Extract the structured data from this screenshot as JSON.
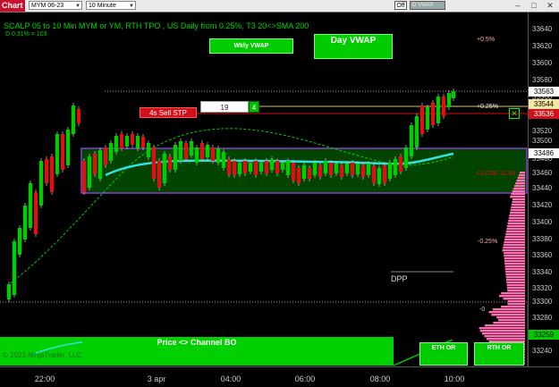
{
  "toolbar": {
    "chart_tab": "Chart",
    "instrument": "MYM 06-23",
    "interval": "10 Minute",
    "off_button": "Off",
    "dvwap_button": "D VWAP"
  },
  "header": {
    "title": "SCALP 05 to 10 Min MYM or YM, RTH TPO , US Daily from 0.25%, T3 20<>SMA 200",
    "subtitle": "D 0,31% = 103"
  },
  "buttons": {
    "wkly_vwap": "Wkly VWAP",
    "day_vwap": "Day VWAP",
    "price_channel": "Price <> Channel BO",
    "eth_or": "ETH OR",
    "rth_or": "RTH OR"
  },
  "order": {
    "sell_label": "4s Sell STP",
    "quantity": "19",
    "side_qty": "4",
    "close_icon": "close-x"
  },
  "labels": {
    "pct_05": "+0.5%",
    "pct_025": "+0.25%",
    "pct_m025": "-0.25%",
    "pct_0": "-0",
    "close": "CLOSE 31.90",
    "dpp": "DPP"
  },
  "copyright": "© 2023 NinjaTrader, LLC",
  "price_axis": {
    "ticks": [
      "33640",
      "33620",
      "33600",
      "33580",
      "33560",
      "33540",
      "33520",
      "33500",
      "33480",
      "33460",
      "33440",
      "33420",
      "33400",
      "33380",
      "33360",
      "33340",
      "33320",
      "33300",
      "33280",
      "33240"
    ],
    "tags": [
      {
        "value": "33563",
        "bg": "#ffffff",
        "fg": "#000000"
      },
      {
        "value": "33544",
        "bg": "#f5e6a0",
        "fg": "#000000"
      },
      {
        "value": "33536",
        "bg": "#d0101a",
        "fg": "#ffffff"
      },
      {
        "value": "33486",
        "bg": "#ffffff",
        "fg": "#000000"
      },
      {
        "value": "33259",
        "bg": "#00cc00",
        "fg": "#000000"
      }
    ]
  },
  "time_axis": {
    "ticks": [
      "22:00",
      "3 apr",
      "04:00",
      "06:00",
      "08:00",
      "10:00"
    ]
  },
  "colors": {
    "up_candle": "#00cc00",
    "down_candle": "#dd1111",
    "box_fill": "#004400",
    "box_border": "#8a3bd6",
    "vwap_line": "#33e0e0",
    "sma_line": "#00cc00",
    "profile": "#ff6fb1"
  }
}
